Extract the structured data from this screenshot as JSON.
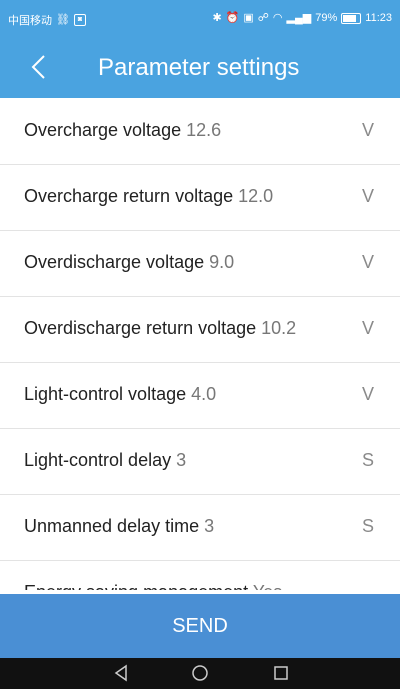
{
  "status_bar": {
    "carrier": "中国移动",
    "battery": "79%",
    "time": "11:23"
  },
  "app_bar": {
    "title": "Parameter settings"
  },
  "params": [
    {
      "label": "Overcharge voltage",
      "value": "12.6",
      "unit": "V"
    },
    {
      "label": "Overcharge return voltage",
      "value": "12.0",
      "unit": "V"
    },
    {
      "label": "Overdischarge voltage",
      "value": "9.0",
      "unit": "V"
    },
    {
      "label": "Overdischarge return voltage",
      "value": "10.2",
      "unit": "V"
    },
    {
      "label": "Light-control voltage",
      "value": "4.0",
      "unit": "V"
    },
    {
      "label": "Light-control delay",
      "value": "3",
      "unit": "S"
    },
    {
      "label": "Unmanned delay time",
      "value": "3",
      "unit": "S"
    },
    {
      "label": "Energy saving management",
      "value": "Yes",
      "unit": ""
    }
  ],
  "send_button": {
    "label": "SEND"
  },
  "colors": {
    "header": "#4aa3e0",
    "send": "#4a8fd4",
    "nav": "#111111"
  },
  "icons": {
    "back": "back-arrow-icon",
    "nav_back": "nav-back-icon",
    "nav_home": "nav-home-icon",
    "nav_recents": "nav-recents-icon"
  }
}
